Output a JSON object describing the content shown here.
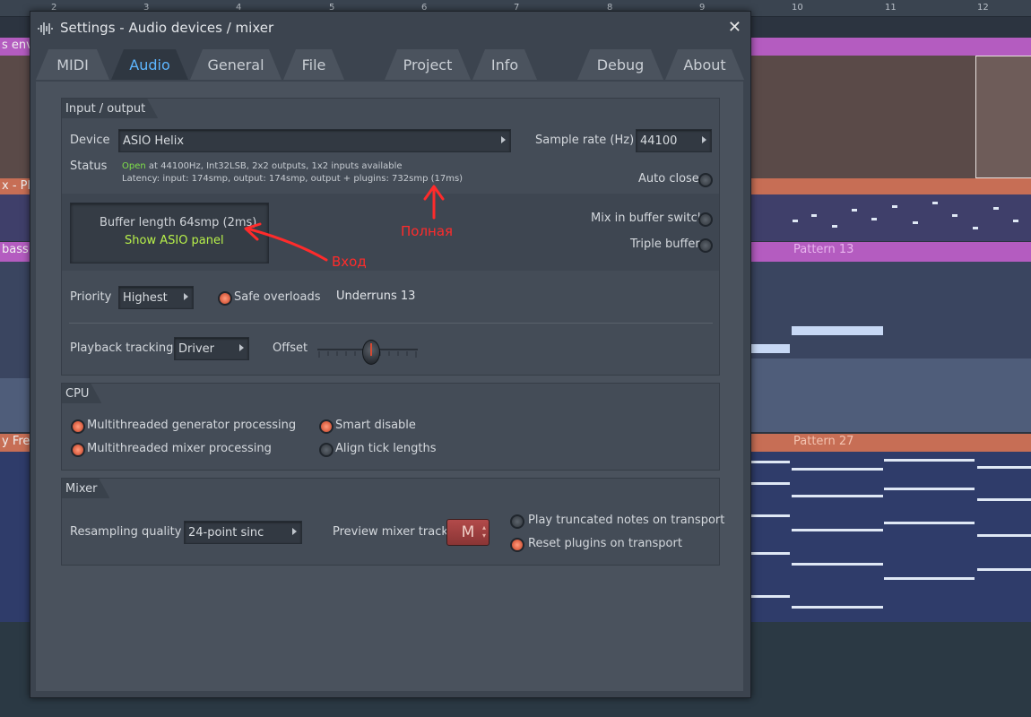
{
  "background": {
    "ruler_numbers": [
      "2",
      "3",
      "4",
      "5",
      "6",
      "7",
      "8",
      "9",
      "10",
      "11",
      "12"
    ],
    "track_labels": [
      "s env",
      "x - Pl",
      "bass",
      "y Fre"
    ],
    "patterns": [
      "Pattern 13",
      "Pattern 27"
    ]
  },
  "dialog": {
    "title": "Settings - Audio devices / mixer",
    "close_symbol": "✕",
    "tabs": [
      {
        "label": "MIDI",
        "active": false
      },
      {
        "label": "Audio",
        "active": true
      },
      {
        "label": "General",
        "active": false
      },
      {
        "label": "File",
        "active": false
      },
      {
        "label": "Project",
        "active": false
      },
      {
        "label": "Info",
        "active": false
      },
      {
        "label": "Debug",
        "active": false
      },
      {
        "label": "About",
        "active": false
      }
    ]
  },
  "io": {
    "header": "Input / output",
    "device_label": "Device",
    "device_value": "ASIO Helix",
    "sample_rate_label": "Sample rate (Hz)",
    "sample_rate_value": "44100",
    "status_label": "Status",
    "status_open": "Open",
    "status_rest": " at 44100Hz, Int32LSB, 2x2 outputs, 1x2 inputs available",
    "latency": "Latency: input: 174smp, output: 174smp, output + plugins: 732smp (17ms)",
    "auto_close": "Auto close",
    "buffer_length": "Buffer length 64smp (2ms)",
    "show_asio": "Show ASIO panel",
    "mix_in_buffer": "Mix in buffer switch",
    "triple_buffer": "Triple buffer",
    "priority_label": "Priority",
    "priority_value": "Highest",
    "safe_overloads": "Safe overloads",
    "underruns": "Underruns 13",
    "playback_label": "Playback tracking",
    "playback_value": "Driver",
    "offset_label": "Offset"
  },
  "cpu": {
    "header": "CPU",
    "mt_generator": "Multithreaded generator processing",
    "mt_mixer": "Multithreaded mixer processing",
    "smart_disable": "Smart disable",
    "align_tick": "Align tick lengths"
  },
  "mixer": {
    "header": "Mixer",
    "resampling_label": "Resampling quality",
    "resampling_value": "24-point sinc",
    "preview_label": "Preview mixer track",
    "preview_value": "M",
    "play_truncated": "Play truncated notes on transport",
    "reset_plugins": "Reset plugins on transport"
  },
  "annotations": {
    "full": "Полная",
    "input": "Вход"
  },
  "colors": {
    "accent_tab": "#5db6ff",
    "status_open": "#7fe04a",
    "show_asio": "#b7f04a",
    "annotation": "#ff2b2b",
    "radio_on": "#e2684a"
  }
}
